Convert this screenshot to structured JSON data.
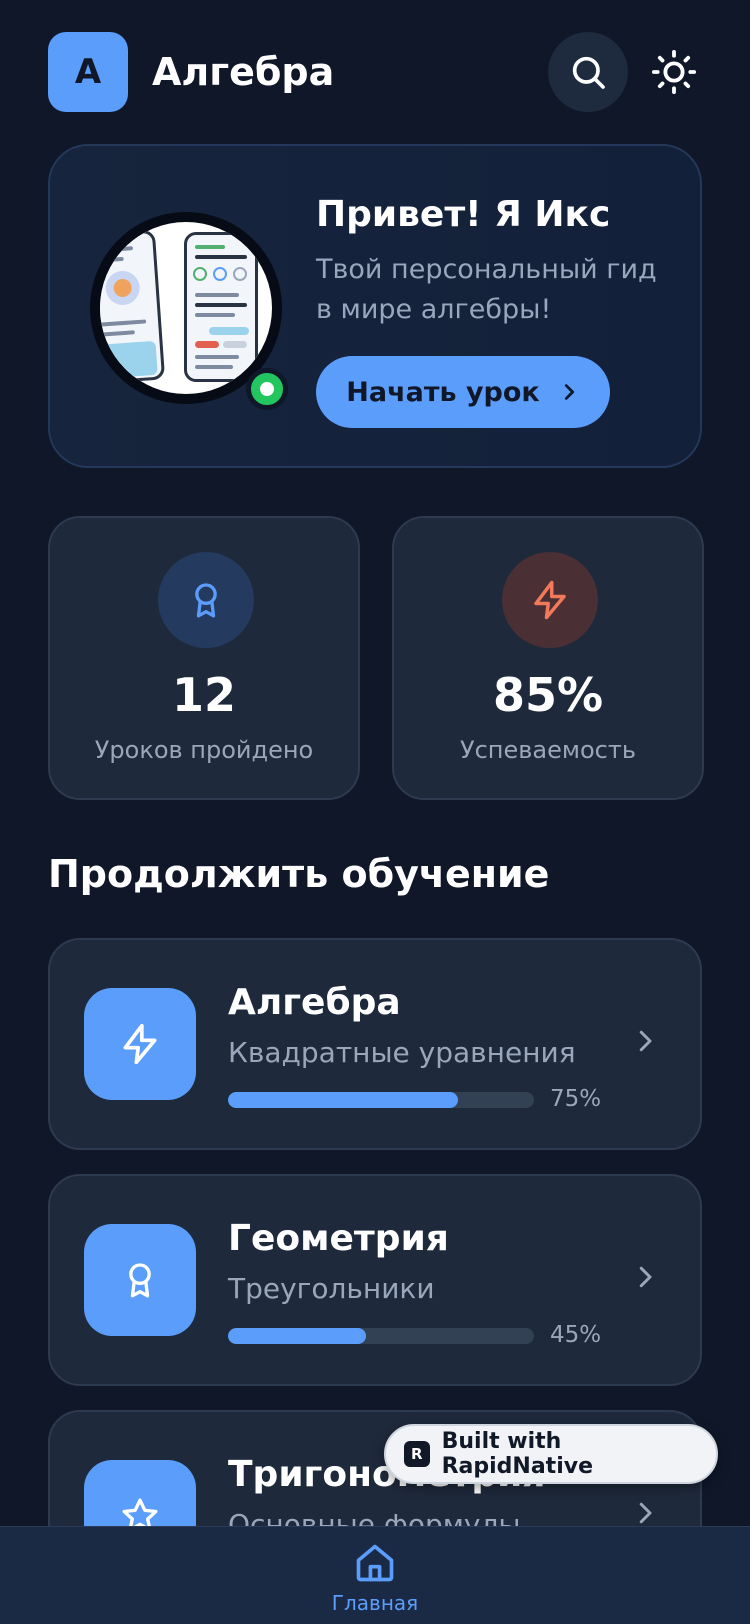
{
  "header": {
    "logo_letter": "A",
    "title": "Алгебра",
    "icons": {
      "search": "search-icon",
      "theme": "sun-icon"
    }
  },
  "hero": {
    "title": "Привет! Я Икс",
    "subtitle": "Твой персональный гид в мире алгебры!",
    "button_label": "Начать урок",
    "status": "online"
  },
  "stats": [
    {
      "value": "12",
      "label": "Уроков пройдено",
      "icon": "award-icon",
      "accent": "#5b9dfb"
    },
    {
      "value": "85%",
      "label": "Успеваемость",
      "icon": "lightning-icon",
      "accent": "#f07a5a"
    }
  ],
  "section": {
    "title": "Продолжить обучение"
  },
  "courses": [
    {
      "name": "Алгебра",
      "topic": "Квадратные уравнения",
      "progress": 75,
      "progress_label": "75%",
      "icon": "lightning-icon"
    },
    {
      "name": "Геометрия",
      "topic": "Треугольники",
      "progress": 45,
      "progress_label": "45%",
      "icon": "award-icon"
    },
    {
      "name": "Тригонометрия",
      "topic": "Основные формулы",
      "icon": "star-icon"
    }
  ],
  "badge": {
    "logo": "R",
    "label": "Built with RapidNative"
  },
  "nav": {
    "home_label": "Главная",
    "icon": "home-icon"
  },
  "colors": {
    "background": "#0f1729",
    "card": "#1e293b",
    "accent": "#5b9dfb",
    "success": "#22c55e"
  }
}
